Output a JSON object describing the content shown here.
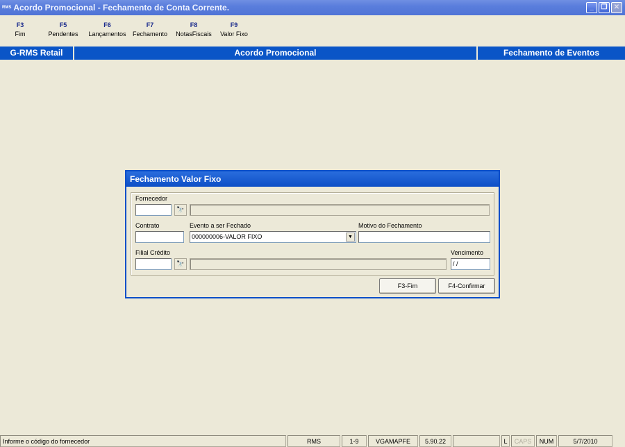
{
  "window": {
    "app_icon_text": "RMS",
    "title": "Acordo Promocional - Fechamento de Conta Corrente.",
    "minimize_glyph": "_",
    "restore_glyph": "❐",
    "close_glyph": "✕"
  },
  "fkeys": [
    {
      "key": "F3",
      "label": "Fim"
    },
    {
      "key": "F5",
      "label": "Pendentes"
    },
    {
      "key": "F6",
      "label": "Lançamentos"
    },
    {
      "key": "F7",
      "label": "Fechamento"
    },
    {
      "key": "F8",
      "label": "NotasFiscais"
    },
    {
      "key": "F9",
      "label": "Valor Fixo"
    }
  ],
  "band": {
    "left": "G-RMS Retail",
    "center": "Acordo Promocional",
    "right": "Fechamento de Eventos"
  },
  "dialog": {
    "title": "Fechamento Valor Fixo",
    "fornecedor_label": "Fornecedor",
    "fornecedor_value": "",
    "fornecedor_desc": "",
    "contrato_label": "Contrato",
    "contrato_value": "",
    "evento_label": "Evento a ser Fechado",
    "evento_value": "000000006-VALOR FIXO",
    "motivo_label": "Motivo do Fechamento",
    "motivo_value": "",
    "filial_label": "Filial Crédito",
    "filial_value": "",
    "filial_desc": "",
    "vencimento_label": "Vencimento",
    "vencimento_value": " / /",
    "search_glyph": "🔭",
    "dropdown_glyph": "▼",
    "btn_fim": "F3-Fim",
    "btn_confirmar": "F4-Confirmar"
  },
  "status": {
    "message": "Informe o código do fornecedor",
    "system": "RMS",
    "range": "1-9",
    "program": "VGAMAPFE",
    "version": "5.90.22",
    "empty": "",
    "lock": "L",
    "caps": "CAPS",
    "num": "NUM",
    "date": "5/7/2010"
  }
}
